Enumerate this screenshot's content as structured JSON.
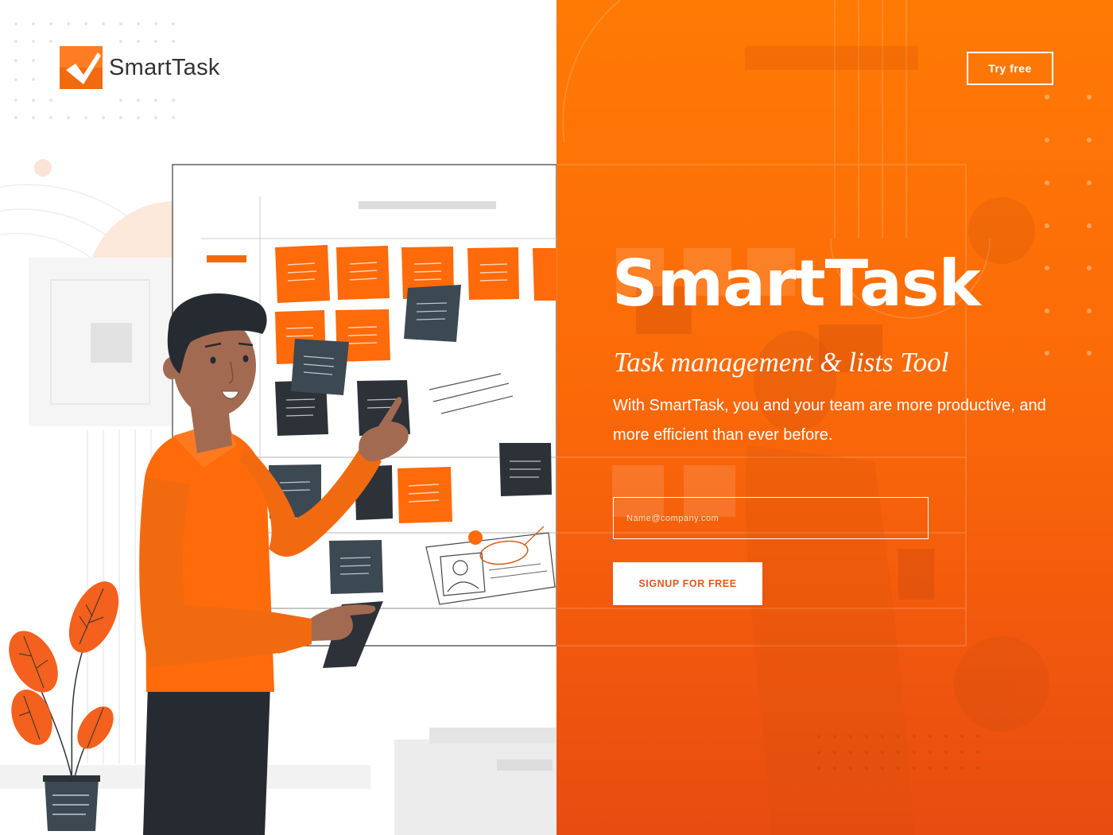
{
  "brand": {
    "name": "SmartTask",
    "accent": "#f26a10"
  },
  "header": {
    "try_label": "Try free"
  },
  "hero": {
    "title": "SmartTask",
    "subtitle": "Task management & lists Tool",
    "description": "With SmartTask, you and your team are more productive, and more efficient than ever before."
  },
  "signup": {
    "email_placeholder": "Name@company.com",
    "button_label": "SIGNUP FOR FREE"
  },
  "colors": {
    "orange_panel": "#fb6a08",
    "dark_note": "#2c3238",
    "slate_note": "#3c4952",
    "orange_note": "#ff6a0b"
  },
  "icons": {
    "logo": "checkmark-logo-icon",
    "illustration": "kanban-board-illustration"
  }
}
